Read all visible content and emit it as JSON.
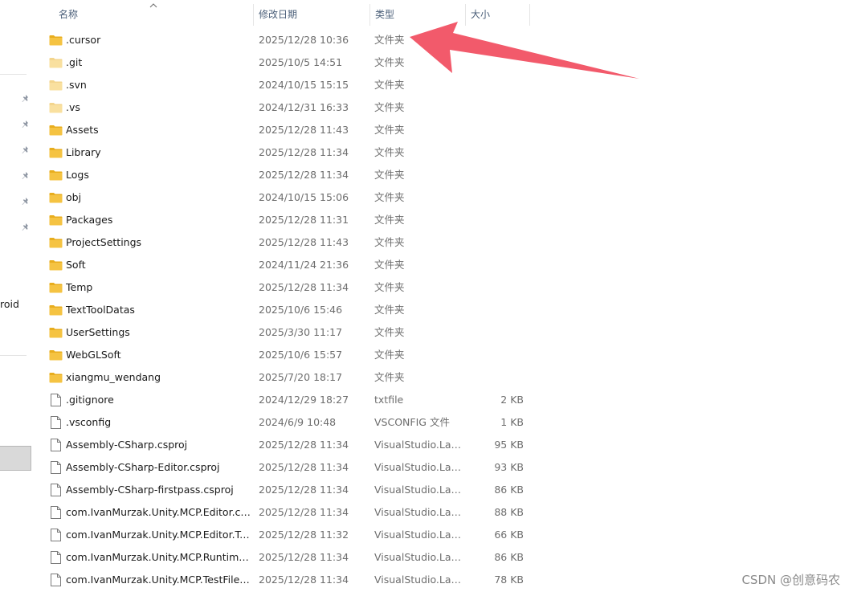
{
  "columns": {
    "name": "名称",
    "modified": "修改日期",
    "type": "类型",
    "size": "大小"
  },
  "nav": {
    "partial_label": "roid"
  },
  "files": [
    {
      "kind": "folder",
      "name": ".cursor",
      "modified": "2025/12/28 10:36",
      "type": "文件夹",
      "size": "",
      "faded": false
    },
    {
      "kind": "folder",
      "name": ".git",
      "modified": "2025/10/5 14:51",
      "type": "文件夹",
      "size": "",
      "faded": true
    },
    {
      "kind": "folder",
      "name": ".svn",
      "modified": "2024/10/15 15:15",
      "type": "文件夹",
      "size": "",
      "faded": true
    },
    {
      "kind": "folder",
      "name": ".vs",
      "modified": "2024/12/31 16:33",
      "type": "文件夹",
      "size": "",
      "faded": true
    },
    {
      "kind": "folder",
      "name": "Assets",
      "modified": "2025/12/28 11:43",
      "type": "文件夹",
      "size": "",
      "faded": false
    },
    {
      "kind": "folder",
      "name": "Library",
      "modified": "2025/12/28 11:34",
      "type": "文件夹",
      "size": "",
      "faded": false
    },
    {
      "kind": "folder",
      "name": "Logs",
      "modified": "2025/12/28 11:34",
      "type": "文件夹",
      "size": "",
      "faded": false
    },
    {
      "kind": "folder",
      "name": "obj",
      "modified": "2024/10/15 15:06",
      "type": "文件夹",
      "size": "",
      "faded": false
    },
    {
      "kind": "folder",
      "name": "Packages",
      "modified": "2025/12/28 11:31",
      "type": "文件夹",
      "size": "",
      "faded": false
    },
    {
      "kind": "folder",
      "name": "ProjectSettings",
      "modified": "2025/12/28 11:43",
      "type": "文件夹",
      "size": "",
      "faded": false
    },
    {
      "kind": "folder",
      "name": "Soft",
      "modified": "2024/11/24 21:36",
      "type": "文件夹",
      "size": "",
      "faded": false
    },
    {
      "kind": "folder",
      "name": "Temp",
      "modified": "2025/12/28 11:34",
      "type": "文件夹",
      "size": "",
      "faded": false
    },
    {
      "kind": "folder",
      "name": "TextToolDatas",
      "modified": "2025/10/6 15:46",
      "type": "文件夹",
      "size": "",
      "faded": false
    },
    {
      "kind": "folder",
      "name": "UserSettings",
      "modified": "2025/3/30 11:17",
      "type": "文件夹",
      "size": "",
      "faded": false
    },
    {
      "kind": "folder",
      "name": "WebGLSoft",
      "modified": "2025/10/6 15:57",
      "type": "文件夹",
      "size": "",
      "faded": false
    },
    {
      "kind": "folder",
      "name": "xiangmu_wendang",
      "modified": "2025/7/20 18:17",
      "type": "文件夹",
      "size": "",
      "faded": false
    },
    {
      "kind": "file",
      "name": ".gitignore",
      "modified": "2024/12/29 18:27",
      "type": "txtfile",
      "size": "2 KB",
      "faded": false
    },
    {
      "kind": "file",
      "name": ".vsconfig",
      "modified": "2024/6/9 10:48",
      "type": "VSCONFIG 文件",
      "size": "1 KB",
      "faded": false
    },
    {
      "kind": "file",
      "name": "Assembly-CSharp.csproj",
      "modified": "2025/12/28 11:34",
      "type": "VisualStudio.Lau...",
      "size": "95 KB",
      "faded": false
    },
    {
      "kind": "file",
      "name": "Assembly-CSharp-Editor.csproj",
      "modified": "2025/12/28 11:34",
      "type": "VisualStudio.Lau...",
      "size": "93 KB",
      "faded": false
    },
    {
      "kind": "file",
      "name": "Assembly-CSharp-firstpass.csproj",
      "modified": "2025/12/28 11:34",
      "type": "VisualStudio.Lau...",
      "size": "86 KB",
      "faded": false
    },
    {
      "kind": "file",
      "name": "com.IvanMurzak.Unity.MCP.Editor.cs...",
      "modified": "2025/12/28 11:34",
      "type": "VisualStudio.Lau...",
      "size": "88 KB",
      "faded": false
    },
    {
      "kind": "file",
      "name": "com.IvanMurzak.Unity.MCP.Editor.Te...",
      "modified": "2025/12/28 11:32",
      "type": "VisualStudio.Lau...",
      "size": "66 KB",
      "faded": false
    },
    {
      "kind": "file",
      "name": "com.IvanMurzak.Unity.MCP.Runtime.c...",
      "modified": "2025/12/28 11:34",
      "type": "VisualStudio.Lau...",
      "size": "86 KB",
      "faded": false
    },
    {
      "kind": "file",
      "name": "com.IvanMurzak.Unity.MCP.TestFiles....",
      "modified": "2025/12/28 11:34",
      "type": "VisualStudio.Lau...",
      "size": "78 KB",
      "faded": false
    }
  ],
  "annotation": {
    "arrow_color": "#f25a6b",
    "points_to": ".cursor"
  },
  "watermark": "CSDN @创意码农",
  "icons": {
    "folder": "folder-icon",
    "file": "file-icon",
    "pin": "pin-icon",
    "sort": "sort-up-icon"
  },
  "colors": {
    "folder_body": "#f5c342",
    "folder_tab": "#e8ad1d",
    "header_text": "#4c607a",
    "secondary_text": "#6d6d6d"
  }
}
